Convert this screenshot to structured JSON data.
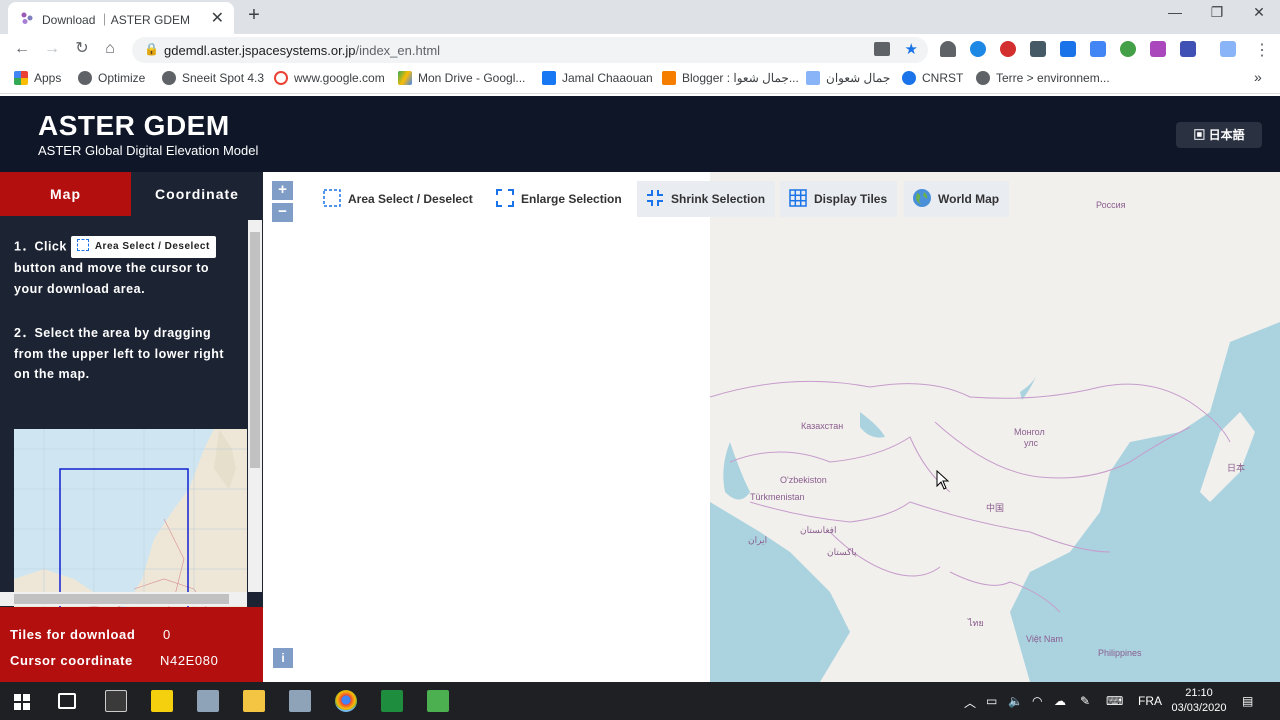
{
  "browser": {
    "tab_title": "Download ｜ASTER GDEM",
    "url_host": "gdemdl.aster.jspacesystems.or.jp",
    "url_path": "/index_en.html",
    "bookmarks": [
      {
        "label": "Apps",
        "color": "#4285f4"
      },
      {
        "label": "Optimize",
        "color": "#5f6368"
      },
      {
        "label": "Sneeit Spot 4.3",
        "color": "#5f6368"
      },
      {
        "label": "www.google.com",
        "color": "#ea4335"
      },
      {
        "label": "Mon Drive - Googl...",
        "color": "#fbbc04"
      },
      {
        "label": "Jamal Chaaouan",
        "color": "#1877f2"
      },
      {
        "label": "Blogger : جمال شعوا...",
        "color": "#f57d00"
      },
      {
        "label": "جمال شعوان",
        "color": "#5f6368"
      },
      {
        "label": "CNRST",
        "color": "#1a73e8"
      },
      {
        "label": "Terre > environnem...",
        "color": "#5f6368"
      }
    ]
  },
  "site": {
    "title": "ASTER GDEM",
    "subtitle": "ASTER Global Digital Elevation Model",
    "language_button": "日本語"
  },
  "sidebar": {
    "tabs": {
      "map": "Map",
      "coordinate": "Coordinate"
    },
    "step1_prefix": "1．Click",
    "step1_button": "Area Select / Deselect",
    "step1_suffix": "button and move the cursor to your download area.",
    "step2": "2．Select the area by dragging from the upper left to lower right on the map.",
    "tiles_label": "Tiles for download",
    "tiles_value": "0",
    "cursor_label": "Cursor coordinate",
    "cursor_value": "N42E080"
  },
  "map_tools": {
    "zoom_in": "+",
    "zoom_out": "−",
    "area_select": "Area Select / Deselect",
    "enlarge": "Enlarge Selection",
    "shrink": "Shrink Selection",
    "display_tiles": "Display Tiles",
    "world_map": "World Map",
    "info": "i"
  },
  "map_labels": {
    "russia": "Россия",
    "kazakhstan": "Казахстан",
    "mongolia_1": "Монгол",
    "mongolia_2": "улс",
    "uzbekistan": "O'zbekiston",
    "turkmenistan": "Türkmenistan",
    "japan": "日本",
    "china": "中国",
    "afghanistan": "افغانستان",
    "iran": "ایران",
    "pakistan": "پاکستان",
    "vietnam": "Việt Nam",
    "philippines": "Philippines",
    "thailand": "ไทย"
  },
  "taskbar": {
    "language": "FRA",
    "time": "21:10",
    "date": "03/03/2020"
  }
}
